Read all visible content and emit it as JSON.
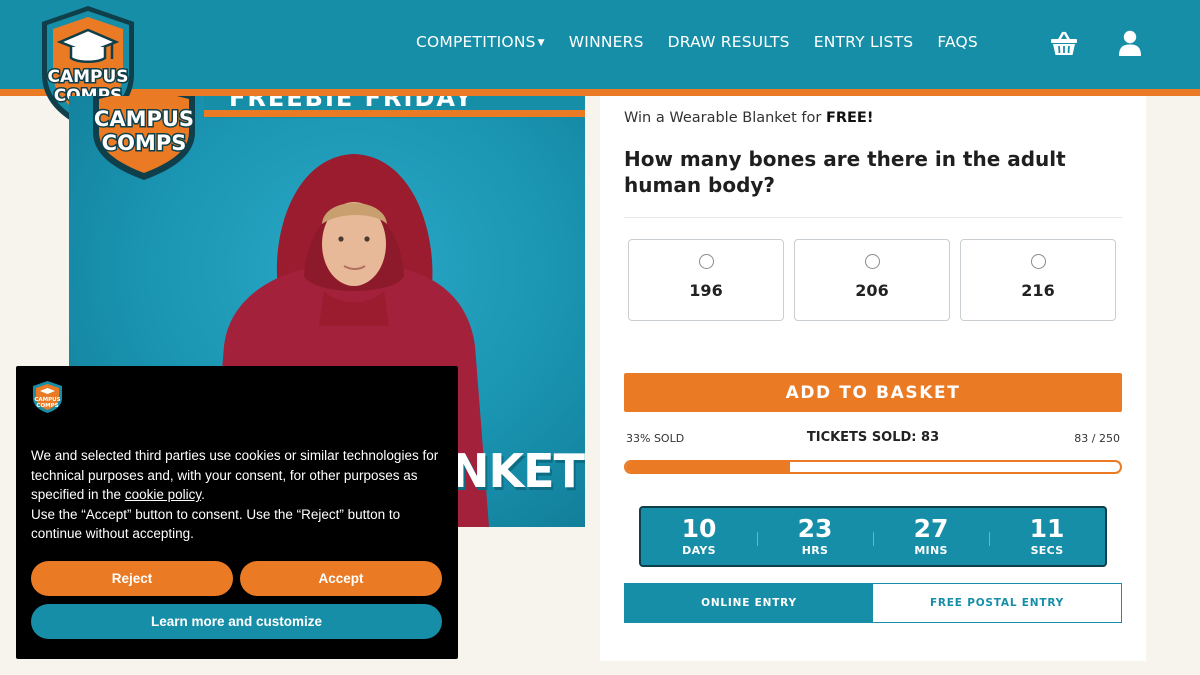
{
  "brand": {
    "logo_text_line1": "CAMPUS",
    "logo_text_line2": "COMPS",
    "colors": {
      "teal": "#178ea8",
      "orange": "#ea7a24",
      "dark": "#0f3f4a"
    }
  },
  "nav": {
    "items": [
      {
        "label": "COMPETITIONS",
        "has_dropdown": true
      },
      {
        "label": "WINNERS"
      },
      {
        "label": "DRAW RESULTS"
      },
      {
        "label": "ENTRY LISTS"
      },
      {
        "label": "FAQS"
      }
    ],
    "icons": [
      "basket-icon",
      "user-icon"
    ]
  },
  "product_image": {
    "promo_text": "FREEBIE FRIDAY",
    "product_word": "NKET"
  },
  "competition": {
    "win_prefix": "Win a Wearable Blanket for ",
    "win_emphasis": "FREE!",
    "question": "How many bones are there in the adult human body?",
    "answers": [
      {
        "value": "196"
      },
      {
        "value": "206"
      },
      {
        "value": "216"
      }
    ],
    "add_to_basket_label": "ADD TO BASKET",
    "sold_percent_label": "33% SOLD",
    "tickets_sold_label": "TICKETS SOLD: 83",
    "tickets_count_label": "83 / 250",
    "progress_fraction": 0.332,
    "countdown": [
      {
        "value": "10",
        "unit": "DAYS"
      },
      {
        "value": "23",
        "unit": "HRS"
      },
      {
        "value": "27",
        "unit": "MINS"
      },
      {
        "value": "11",
        "unit": "SECS"
      }
    ],
    "entry_tabs": [
      {
        "label": "ONLINE ENTRY",
        "active": true
      },
      {
        "label": "FREE POSTAL ENTRY",
        "active": false
      }
    ]
  },
  "cookie_banner": {
    "text_before_link": "We and selected third parties use cookies or similar technologies for technical purposes and, with your consent, for other purposes as specified in the ",
    "link_text": "cookie policy",
    "text_after_link": ".",
    "text_line2": "Use the “Accept” button to consent. Use the “Reject” button to continue without accepting.",
    "reject_label": "Reject",
    "accept_label": "Accept",
    "learn_more_label": "Learn more and customize"
  }
}
